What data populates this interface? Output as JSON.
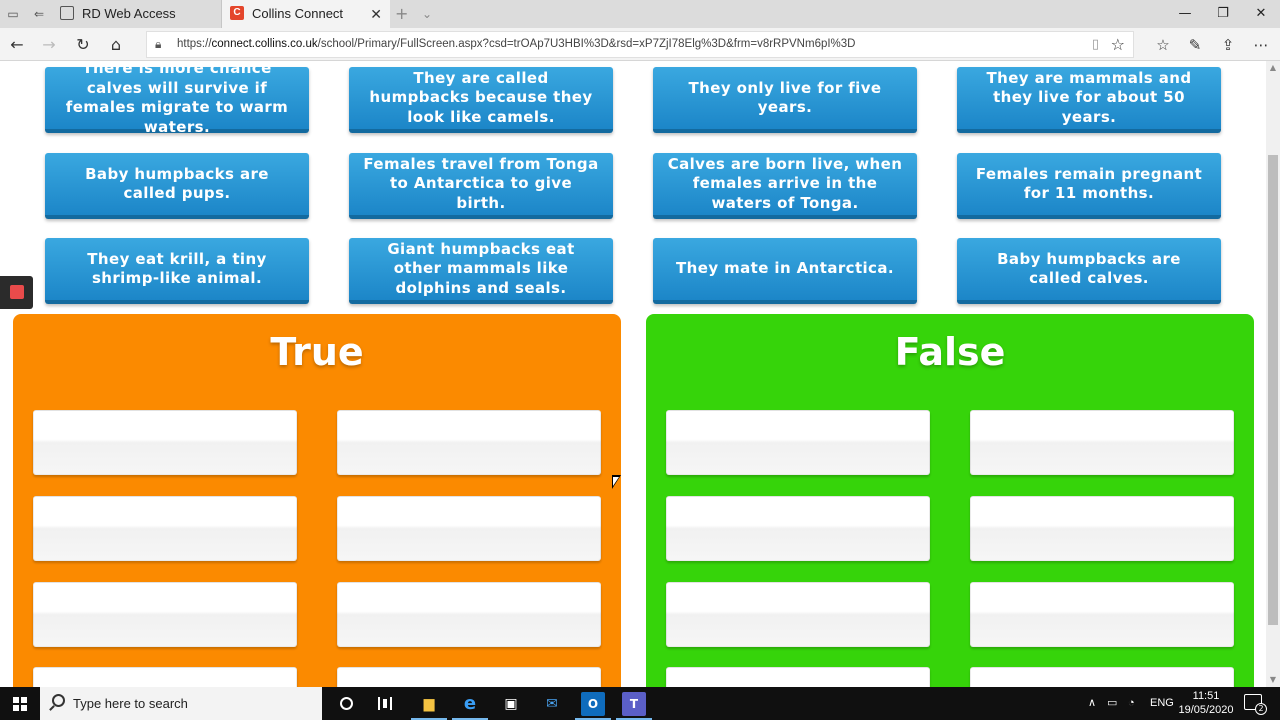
{
  "browser": {
    "tabs": [
      {
        "label": "RD Web Access",
        "active": false
      },
      {
        "label": "Collins Connect",
        "active": true
      }
    ],
    "favicon_letter": "C",
    "url_prefix": "https://",
    "url_host": "connect.collins.co.uk",
    "url_path": "/school/Primary/FullScreen.aspx?csd=trOAp7U3HBI%3D&rsd=xP7ZjI78Elg%3D&frm=v8rRPVNm6pI%3D",
    "icons": [
      "back-icon",
      "forward-icon",
      "refresh-icon",
      "home-icon",
      "lock-icon",
      "reading-view-icon",
      "favorite-star-icon",
      "favorites-icon",
      "pen-icon",
      "share-icon",
      "more-icon"
    ]
  },
  "activity": {
    "cards": [
      "There is more chance calves will survive if females migrate to warm waters.",
      "They are called humpbacks because they look like camels.",
      "They only live for five years.",
      "They are mammals and they live for about 50 years.",
      "Baby humpbacks are called pups.",
      "Females travel from Tonga to Antarctica to give birth.",
      "Calves are born live, when females arrive in the waters of Tonga.",
      "Females remain pregnant for 11 months.",
      "They eat krill, a tiny shrimp-like animal.",
      "Giant humpbacks eat other mammals like dolphins and seals.",
      "They mate in Antarctica.",
      "Baby humpbacks are called calves."
    ],
    "true_title": "True",
    "false_title": "False",
    "colors": {
      "card": "#1c86c8",
      "true_panel": "#fb8a00",
      "false_panel": "#36d40a"
    }
  },
  "taskbar": {
    "search_placeholder": "Type here to search",
    "language": "ENG",
    "time": "11:51",
    "date": "19/05/2020",
    "notification_count": "2"
  }
}
